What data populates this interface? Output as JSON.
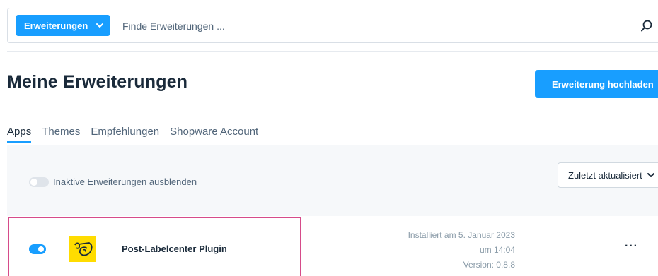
{
  "search": {
    "scope_label": "Erweiterungen",
    "placeholder": "Finde Erweiterungen ..."
  },
  "header": {
    "title": "Meine Erweiterungen",
    "upload_label": "Erweiterung hochladen"
  },
  "tabs": [
    {
      "label": "Apps",
      "active": true
    },
    {
      "label": "Themes",
      "active": false
    },
    {
      "label": "Empfehlungen",
      "active": false
    },
    {
      "label": "Shopware Account",
      "active": false
    }
  ],
  "filter": {
    "hide_inactive_label": "Inaktive Erweiterungen ausblenden",
    "sort_label": "Zuletzt aktualisiert"
  },
  "extensions": [
    {
      "name": "Post-Labelcenter Plugin",
      "installed_line1": "Installiert am 5. Januar 2023",
      "installed_line2": "um 14:04",
      "version": "Version: 0.8.8",
      "active": true,
      "more_label": "···"
    }
  ],
  "colors": {
    "accent": "#189eff",
    "logo_yellow": "#ffdc00",
    "highlight": "#d64b8a"
  }
}
